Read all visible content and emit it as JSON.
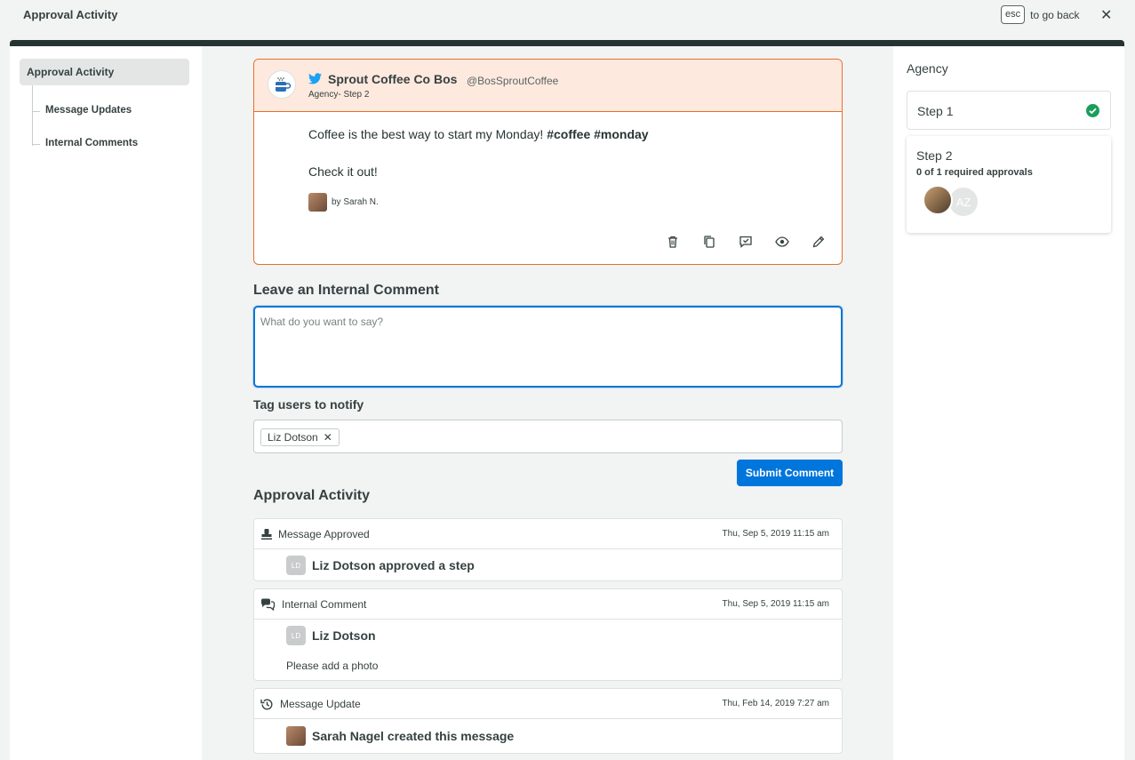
{
  "window": {
    "title": "Approval Activity",
    "esc_key": "esc",
    "esc_hint": "to go back",
    "close_symbol": "✕"
  },
  "sidebar": {
    "active": "Approval Activity",
    "items": [
      {
        "label": "Message Updates"
      },
      {
        "label": "Internal Comments"
      }
    ]
  },
  "post": {
    "account_name": "Sprout Coffee Co Bos",
    "handle": "@BosSproutCoffee",
    "sub": "Agency- Step 2",
    "text_plain": "Coffee is the best way to start my Monday!",
    "hashtags": "#coffee #monday",
    "text_line2": "Check it out!",
    "author": "by Sarah N.",
    "network_icon": "twitter-icon",
    "actions": [
      "trash-icon",
      "duplicate-icon",
      "comment-icon",
      "preview-icon",
      "edit-icon"
    ]
  },
  "comment": {
    "heading": "Leave an Internal Comment",
    "placeholder": "What do you want to say?",
    "tag_label": "Tag users to notify",
    "tags": [
      {
        "name": "Liz Dotson",
        "remove": "✕"
      }
    ],
    "submit_label": "Submit Comment"
  },
  "activity": {
    "heading": "Approval Activity",
    "items": [
      {
        "type": "Message Approved",
        "time": "Thu, Sep 5, 2019 11:15 am",
        "initials": "LD",
        "text": "Liz Dotson approved a step",
        "icon": "stamp-icon"
      },
      {
        "type": "Internal Comment",
        "time": "Thu, Sep 5, 2019 11:15 am",
        "initials": "LD",
        "text": "Liz Dotson",
        "comment": "Please add a photo",
        "icon": "comments-icon"
      },
      {
        "type": "Message Update",
        "time": "Thu, Feb 14, 2019 7:27 am",
        "text": "Sarah Nagel created this message",
        "icon": "history-icon"
      }
    ]
  },
  "approvals": {
    "group": "Agency",
    "steps": [
      {
        "label": "Step 1",
        "status": "complete"
      },
      {
        "label": "Step 2",
        "requirement": "0 of 1 required approvals",
        "approver_initials": "AZ"
      }
    ],
    "colors": {
      "accent": "#0075db",
      "complete": "#1b9e59",
      "post_border": "#e8702a",
      "post_header": "#fde9de"
    }
  }
}
